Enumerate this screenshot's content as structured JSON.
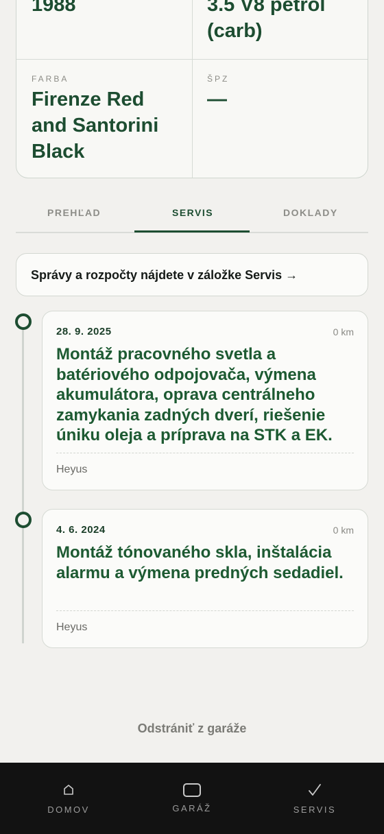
{
  "specs": {
    "year": "1988",
    "engine": "3.5 V8 petrol (carb)",
    "color_label": "FARBA",
    "color_value": "Firenze Red and Santorini Black",
    "plate_label": "ŠPZ",
    "plate_value": "—"
  },
  "tabs": [
    {
      "label": "PREHĽAD",
      "active": false
    },
    {
      "label": "SERVIS",
      "active": true
    },
    {
      "label": "DOKLADY",
      "active": false
    }
  ],
  "notice": "Správy a rozpočty nájdete v záložke Servis →",
  "entries": [
    {
      "date": "28. 9. 2025",
      "km": "0 km",
      "title": "Montáž pracovného svetla a batériového odpojovača, výmena akumulátora, oprava centrálneho zamykania zadných dverí, riešenie úniku oleja a príprava na STK a EK.",
      "who": "Heyus"
    },
    {
      "date": "4. 6. 2024",
      "km": "0 km",
      "title": "Montáž tónovaného skla, inštalácia alarmu a výmena predných sedadiel.",
      "who": "Heyus"
    }
  ],
  "remove_label": "Odstrániť z garáže",
  "nav": [
    {
      "label": "DOMOV",
      "icon": "home-icon"
    },
    {
      "label": "GARÁŽ",
      "icon": "garage-icon"
    },
    {
      "label": "SERVIS",
      "icon": "check-icon"
    }
  ],
  "colors": {
    "accent": "#1d4d31",
    "background": "#f2f1ee",
    "nav_background": "#121212"
  }
}
